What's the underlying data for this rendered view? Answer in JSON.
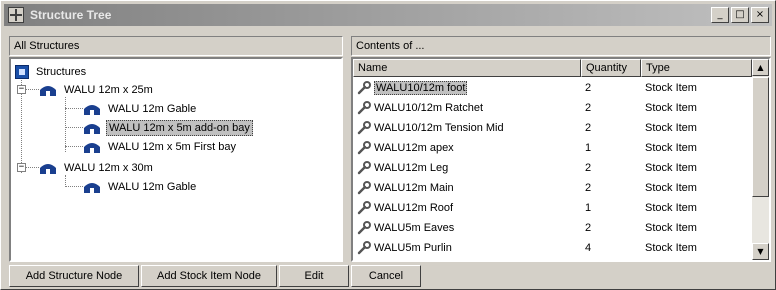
{
  "window": {
    "title": "Structure Tree",
    "controls": {
      "minimize": "_",
      "maximize": "□",
      "close": "×"
    }
  },
  "left_panel": {
    "label": "All Structures",
    "tree": {
      "root": "Structures",
      "nodes": [
        {
          "label": "WALU 12m x 25m",
          "children": [
            "WALU 12m Gable",
            "WALU 12m x 5m add-on bay",
            "WALU 12m x 5m First bay"
          ]
        },
        {
          "label": "WALU 12m x 30m",
          "children": [
            "WALU 12m Gable"
          ]
        }
      ],
      "selected": "WALU 12m x 5m add-on bay"
    }
  },
  "right_panel": {
    "label": "Contents of ...",
    "columns": [
      "Name",
      "Quantity",
      "Type"
    ],
    "rows": [
      {
        "name": "WALU10/12m foot",
        "quantity": "2",
        "type": "Stock Item"
      },
      {
        "name": "WALU10/12m Ratchet",
        "quantity": "2",
        "type": "Stock Item"
      },
      {
        "name": "WALU10/12m Tension Mid",
        "quantity": "2",
        "type": "Stock Item"
      },
      {
        "name": "WALU12m apex",
        "quantity": "1",
        "type": "Stock Item"
      },
      {
        "name": "WALU12m Leg",
        "quantity": "2",
        "type": "Stock Item"
      },
      {
        "name": "WALU12m Main",
        "quantity": "2",
        "type": "Stock Item"
      },
      {
        "name": "WALU12m Roof",
        "quantity": "1",
        "type": "Stock Item"
      },
      {
        "name": "WALU5m Eaves",
        "quantity": "2",
        "type": "Stock Item"
      },
      {
        "name": "WALU5m Purlin",
        "quantity": "4",
        "type": "Stock Item"
      }
    ]
  },
  "buttons": {
    "add_structure": "Add Structure Node",
    "add_stock": "Add Stock Item Node",
    "edit": "Edit",
    "cancel": "Cancel"
  },
  "icons": {
    "app": "tree-cross-icon",
    "root": "blue-square-icon",
    "structure": "tent-icon",
    "item": "wrench-icon"
  }
}
